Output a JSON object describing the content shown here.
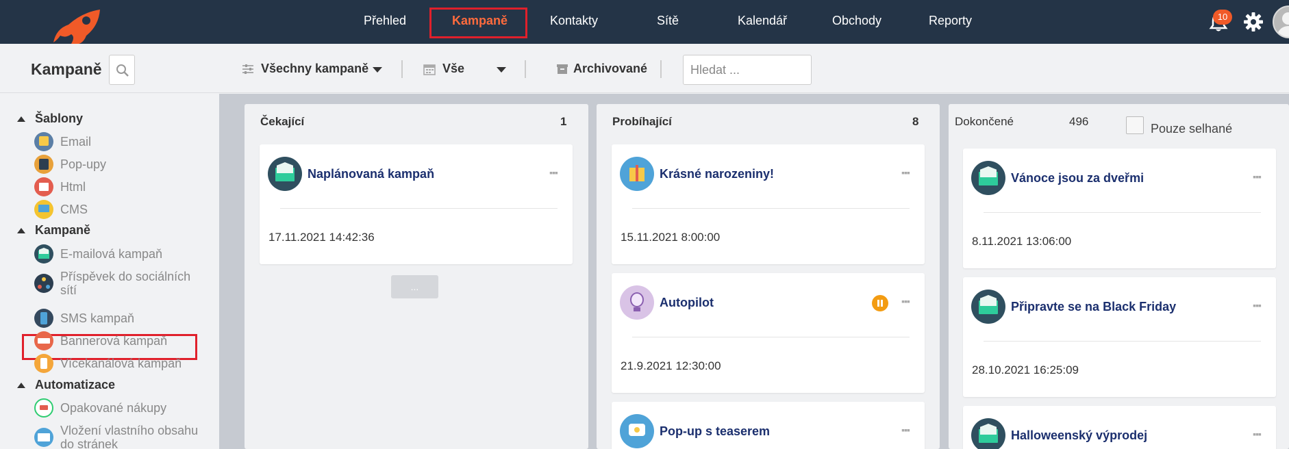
{
  "nav": {
    "items": [
      "Přehled",
      "Kampaně",
      "Kontakty",
      "Sítě",
      "Kalendář",
      "Obchody",
      "Reporty"
    ],
    "active": "Kampaně",
    "notifications_count": "10"
  },
  "toolbar": {
    "page_title": "Kampaně",
    "filter_campaigns": "Všechny kampaně",
    "filter_time": "Vše",
    "archived": "Archivované",
    "search_placeholder": "Hledat ..."
  },
  "sidebar": {
    "groups": [
      {
        "label": "Šablony",
        "items": [
          "Email",
          "Pop-upy",
          "Html",
          "CMS"
        ]
      },
      {
        "label": "Kampaně",
        "items": [
          "E-mailová kampaň",
          "Příspěvek do sociálních sítí",
          "SMS kampaň",
          "Bannerová kampaň",
          "Vícekanálová kampaň"
        ]
      },
      {
        "label": "Automatizace",
        "items": [
          "Opakované nákupy",
          "Vložení vlastního obsahu do stránek"
        ]
      }
    ]
  },
  "board": {
    "columns": [
      {
        "title": "Čekající",
        "count": "1",
        "cards": [
          {
            "name": "Naplánovaná kampaň",
            "date": "17.11.2021 14:42:36",
            "icon": "envelope-icon"
          }
        ],
        "more_label": "..."
      },
      {
        "title": "Probíhající",
        "count": "8",
        "cards": [
          {
            "name": "Krásné narozeniny!",
            "date": "15.11.2021 8:00:00",
            "icon": "gift-icon"
          },
          {
            "name": "Autopilot",
            "date": "21.9.2021 12:30:00",
            "icon": "lightbulb-icon",
            "status": "paused"
          },
          {
            "name": "Pop-up s teaserem",
            "date": "",
            "icon": "chat-bubble-icon"
          }
        ]
      },
      {
        "title": "Dokončené",
        "count": "496",
        "filter_label": "Pouze selhané",
        "cards": [
          {
            "name": "Vánoce jsou za dveřmi",
            "date": "8.11.2021 13:06:00",
            "icon": "envelope-icon"
          },
          {
            "name": "Připravte se na Black Friday",
            "date": "28.10.2021 16:25:09",
            "icon": "envelope-icon"
          },
          {
            "name": "Halloweenský výprodej",
            "date": "",
            "icon": "envelope-icon"
          }
        ]
      }
    ]
  },
  "colors": {
    "nav_bg": "#243447",
    "accent": "#ff6b3d",
    "highlight": "#e0202b",
    "card_title": "#1b2f6e",
    "pause": "#f39c12"
  }
}
